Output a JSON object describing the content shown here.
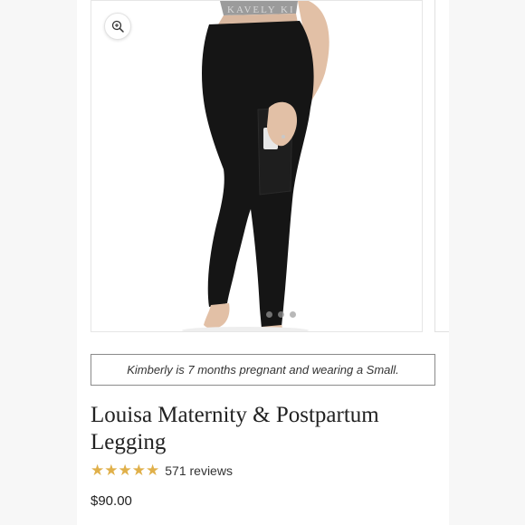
{
  "gallery": {
    "zoom_icon": "zoom-in-icon",
    "waistband_text": "KAVELY KI",
    "slide_dots": 3
  },
  "caption": "Kimberly is 7 months pregnant and wearing a Small.",
  "product": {
    "title": "Louisa Maternity & Postpartum Legging",
    "rating": 5,
    "reviews_label": "571 reviews",
    "price": "$90.00"
  },
  "colors": {
    "star": "#e0b04a",
    "legging": "#151515",
    "text": "#222222"
  }
}
